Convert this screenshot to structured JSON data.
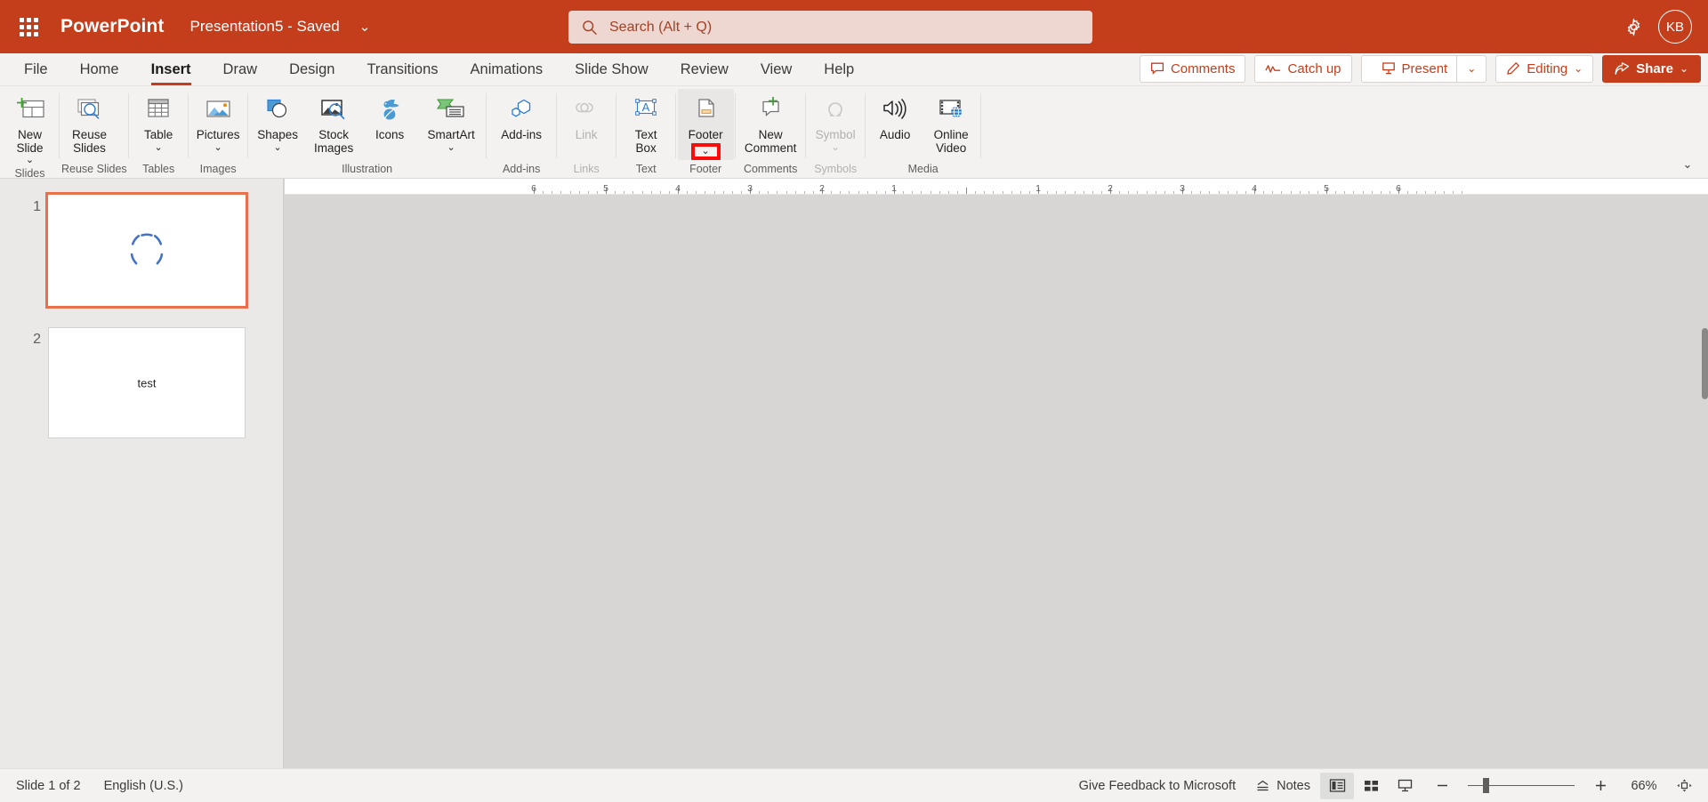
{
  "titlebar": {
    "app_name": "PowerPoint",
    "doc_title": "Presentation5  -  Saved",
    "title_chevron": "⌄",
    "waffle_icon": "app-launcher-icon",
    "gear_icon": "settings-gear-icon",
    "avatar_initials": "KB",
    "brand_color": "#c43e1c"
  },
  "search": {
    "placeholder": "Search (Alt + Q)",
    "value": "",
    "icon": "search-icon"
  },
  "tabs": [
    {
      "label": "File",
      "active": false
    },
    {
      "label": "Home",
      "active": false
    },
    {
      "label": "Insert",
      "active": true
    },
    {
      "label": "Draw",
      "active": false
    },
    {
      "label": "Design",
      "active": false
    },
    {
      "label": "Transitions",
      "active": false
    },
    {
      "label": "Animations",
      "active": false
    },
    {
      "label": "Slide Show",
      "active": false
    },
    {
      "label": "Review",
      "active": false
    },
    {
      "label": "View",
      "active": false
    },
    {
      "label": "Help",
      "active": false
    }
  ],
  "tabstrip_actions": {
    "comments": "Comments",
    "catch_up": "Catch up",
    "present": "Present",
    "present_caret": "⌄",
    "editing": "Editing",
    "editing_caret": "⌄",
    "share": "Share",
    "share_caret": "⌄"
  },
  "ribbon": {
    "collapse_chevron": "⌄",
    "groups": [
      {
        "label": "Slides",
        "dim": false,
        "items": [
          {
            "label": "New\nSlide",
            "icon": "new-slide-icon",
            "chevron": "⌄",
            "disabled": false,
            "wide": false
          }
        ]
      },
      {
        "label": "Reuse Slides",
        "dim": false,
        "items": [
          {
            "label": "Reuse\nSlides",
            "icon": "reuse-slides-icon",
            "chevron": "",
            "disabled": false,
            "wide": false
          }
        ]
      },
      {
        "label": "Tables",
        "dim": false,
        "items": [
          {
            "label": "Table",
            "icon": "table-icon",
            "chevron": "⌄",
            "disabled": false,
            "wide": false
          }
        ]
      },
      {
        "label": "Images",
        "dim": false,
        "items": [
          {
            "label": "Pictures",
            "icon": "pictures-icon",
            "chevron": "⌄",
            "disabled": false,
            "wide": false
          }
        ]
      },
      {
        "label": "Illustration",
        "dim": false,
        "items": [
          {
            "label": "Shapes",
            "icon": "shapes-icon",
            "chevron": "⌄",
            "disabled": false,
            "wide": false
          },
          {
            "label": "Stock\nImages",
            "icon": "stock-images-icon",
            "chevron": "",
            "disabled": false,
            "wide": false
          },
          {
            "label": "Icons",
            "icon": "icons-icon",
            "chevron": "",
            "disabled": false,
            "wide": false
          },
          {
            "label": "SmartArt",
            "icon": "smartart-icon",
            "chevron": "⌄",
            "disabled": false,
            "wide": true
          }
        ]
      },
      {
        "label": "Add-ins",
        "dim": false,
        "items": [
          {
            "label": "Add-ins",
            "icon": "add-ins-icon",
            "chevron": "",
            "disabled": false,
            "wide": true
          }
        ]
      },
      {
        "label": "Links",
        "dim": true,
        "items": [
          {
            "label": "Link",
            "icon": "link-icon",
            "chevron": "",
            "disabled": true,
            "wide": false
          }
        ]
      },
      {
        "label": "Text",
        "dim": false,
        "items": [
          {
            "label": "Text\nBox",
            "icon": "text-box-icon",
            "chevron": "",
            "disabled": false,
            "wide": false
          }
        ]
      },
      {
        "label": "Footer",
        "dim": false,
        "items": [
          {
            "label": "Footer",
            "icon": "footer-icon",
            "chevron": "⌄",
            "disabled": false,
            "wide": false,
            "highlighted_chevron": true,
            "selected": true
          }
        ]
      },
      {
        "label": "Comments",
        "dim": false,
        "items": [
          {
            "label": "New\nComment",
            "icon": "new-comment-icon",
            "chevron": "",
            "disabled": false,
            "wide": true
          }
        ]
      },
      {
        "label": "Symbols",
        "dim": true,
        "items": [
          {
            "label": "Symbol",
            "icon": "symbol-icon",
            "chevron": "⌄",
            "disabled": true,
            "wide": false
          }
        ]
      },
      {
        "label": "Media",
        "dim": false,
        "items": [
          {
            "label": "Audio",
            "icon": "audio-icon",
            "chevron": "",
            "disabled": false,
            "wide": false
          },
          {
            "label": "Online\nVideo",
            "icon": "online-video-icon",
            "chevron": "",
            "disabled": false,
            "wide": false
          }
        ]
      }
    ],
    "highlight_color": "#fc0b0b"
  },
  "thumbnails": [
    {
      "number": "1",
      "text": "",
      "selected": true,
      "loading": true
    },
    {
      "number": "2",
      "text": "test",
      "selected": false,
      "loading": false
    }
  ],
  "ruler": {
    "numbers": [
      "6",
      "5",
      "4",
      "3",
      "2",
      "1",
      "",
      "1",
      "2",
      "3",
      "4",
      "5",
      "6"
    ]
  },
  "statusbar": {
    "slide_count": "Slide 1 of 2",
    "language": "English (U.S.)",
    "feedback": "Give Feedback to Microsoft",
    "notes": "Notes",
    "notes_icon": "notes-icon",
    "normal_view_icon": "normal-view-icon",
    "sorter_view_icon": "slide-sorter-icon",
    "reading_view_icon": "reading-view-icon",
    "zoom_out_icon": "zoom-out-icon",
    "zoom_in_icon": "zoom-in-icon",
    "zoom_percent": "66%",
    "fit_icon": "fit-to-window-icon"
  }
}
